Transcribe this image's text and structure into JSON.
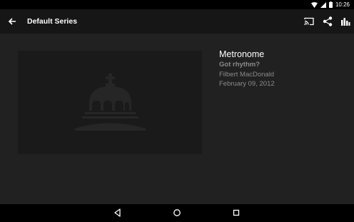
{
  "status_bar": {
    "time": "10:26",
    "icons": [
      "wifi-icon",
      "signal-icon",
      "battery-icon"
    ]
  },
  "app_bar": {
    "title": "Default Series",
    "actions": [
      "cast-icon",
      "share-icon",
      "bar-chart-icon"
    ]
  },
  "episode": {
    "title": "Metronome",
    "subtitle": "Got rhythm?",
    "author": "Filbert MacDonald",
    "date": "February 09, 2012"
  },
  "nav_bar": {
    "buttons": [
      "back-triangle-icon",
      "home-circle-icon",
      "recents-square-icon"
    ]
  },
  "colors": {
    "background": "#212121",
    "app_bar": "#161616",
    "artwork_bg": "#1a1a1a",
    "text_primary": "#ffffff",
    "text_secondary": "#8a8a8a"
  }
}
